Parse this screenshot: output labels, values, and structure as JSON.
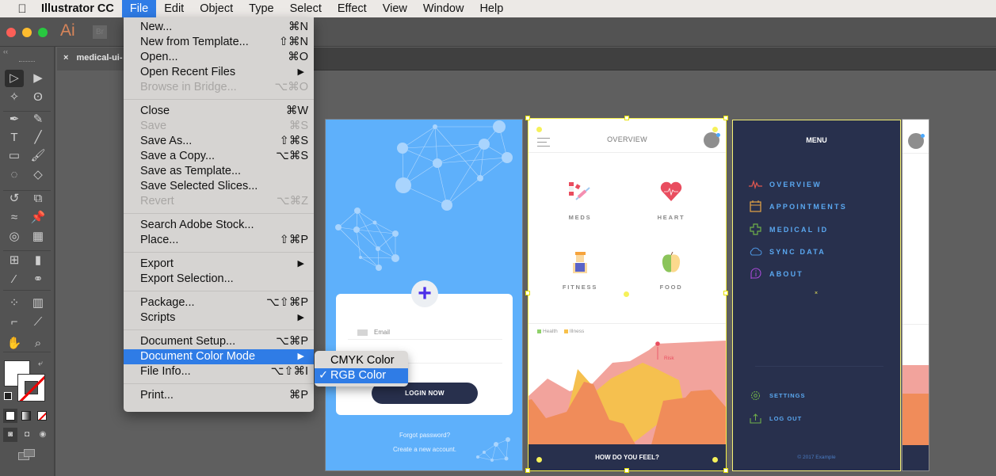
{
  "menubar": {
    "app_name": "Illustrator CC",
    "items": [
      "File",
      "Edit",
      "Object",
      "Type",
      "Select",
      "Effect",
      "View",
      "Window",
      "Help"
    ],
    "active": "File"
  },
  "appbar": {
    "ai_logo": "Ai",
    "br_logo": "Br",
    "traffic_colors": [
      "#fc5f57",
      "#fdbc2e",
      "#28c840"
    ]
  },
  "tab": {
    "close": "×",
    "title": "medical-ui-"
  },
  "toolbar": {
    "collapse": "‹‹",
    "tools": [
      {
        "name": "selection-tool",
        "glyph": "▷",
        "selected": true
      },
      {
        "name": "direct-selection-tool",
        "glyph": "▶"
      },
      {
        "name": "magic-wand-tool",
        "glyph": "✧"
      },
      {
        "name": "lasso-tool",
        "glyph": "ʘ"
      },
      {
        "name": "pen-tool",
        "glyph": "✒"
      },
      {
        "name": "curvature-tool",
        "glyph": "✎"
      },
      {
        "name": "type-tool",
        "glyph": "T"
      },
      {
        "name": "line-tool",
        "glyph": "╱"
      },
      {
        "name": "rectangle-tool",
        "glyph": "▭"
      },
      {
        "name": "paintbrush-tool",
        "glyph": "🖌"
      },
      {
        "name": "shaper-tool",
        "glyph": "◌"
      },
      {
        "name": "eraser-tool",
        "glyph": "◇"
      },
      {
        "name": "rotate-tool",
        "glyph": "↺"
      },
      {
        "name": "scale-tool",
        "glyph": "⧉"
      },
      {
        "name": "warp-tool",
        "glyph": "≈"
      },
      {
        "name": "puppet-warp-tool",
        "glyph": "📌"
      },
      {
        "name": "shape-builder-tool",
        "glyph": "◎"
      },
      {
        "name": "perspective-grid-tool",
        "glyph": "▦"
      },
      {
        "name": "mesh-tool",
        "glyph": "⊞"
      },
      {
        "name": "gradient-tool",
        "glyph": "▮"
      },
      {
        "name": "eyedropper-tool",
        "glyph": "⁄"
      },
      {
        "name": "blend-tool",
        "glyph": "⚭"
      },
      {
        "name": "symbol-sprayer-tool",
        "glyph": "⁘"
      },
      {
        "name": "column-graph-tool",
        "glyph": "▥"
      },
      {
        "name": "artboard-tool",
        "glyph": "⌐"
      },
      {
        "name": "slice-tool",
        "glyph": "⟋"
      },
      {
        "name": "hand-tool",
        "glyph": "✋"
      },
      {
        "name": "zoom-tool",
        "glyph": "⌕"
      }
    ]
  },
  "file_menu": {
    "groups": [
      [
        {
          "label": "New...",
          "shortcut": "⌘N"
        },
        {
          "label": "New from Template...",
          "shortcut": "⇧⌘N"
        },
        {
          "label": "Open...",
          "shortcut": "⌘O"
        },
        {
          "label": "Open Recent Files",
          "submenu": true
        },
        {
          "label": "Browse in Bridge...",
          "shortcut": "⌥⌘O",
          "disabled": true
        }
      ],
      [
        {
          "label": "Close",
          "shortcut": "⌘W"
        },
        {
          "label": "Save",
          "shortcut": "⌘S",
          "disabled": true
        },
        {
          "label": "Save As...",
          "shortcut": "⇧⌘S"
        },
        {
          "label": "Save a Copy...",
          "shortcut": "⌥⌘S"
        },
        {
          "label": "Save as Template..."
        },
        {
          "label": "Save Selected Slices..."
        },
        {
          "label": "Revert",
          "shortcut": "⌥⌘Z",
          "disabled": true
        }
      ],
      [
        {
          "label": "Search Adobe Stock..."
        },
        {
          "label": "Place...",
          "shortcut": "⇧⌘P"
        }
      ],
      [
        {
          "label": "Export",
          "submenu": true
        },
        {
          "label": "Export Selection..."
        }
      ],
      [
        {
          "label": "Package...",
          "shortcut": "⌥⇧⌘P"
        },
        {
          "label": "Scripts",
          "submenu": true
        }
      ],
      [
        {
          "label": "Document Setup...",
          "shortcut": "⌥⌘P"
        },
        {
          "label": "Document Color Mode",
          "submenu": true,
          "highlighted": true
        },
        {
          "label": "File Info...",
          "shortcut": "⌥⇧⌘I"
        }
      ],
      [
        {
          "label": "Print...",
          "shortcut": "⌘P"
        }
      ]
    ]
  },
  "color_mode_submenu": {
    "items": [
      {
        "label": "CMYK Color",
        "checked": false
      },
      {
        "label": "RGB Color",
        "checked": true
      }
    ],
    "check_glyph": "✓"
  },
  "login_screen": {
    "email_placeholder": "Email",
    "login_button": "LOGIN NOW",
    "forgot": "Forgot password?",
    "create": "Create a new account.",
    "bg_color": "#5eb0fb",
    "plus_color": "#4b2de8"
  },
  "overview_screen": {
    "title": "OVERVIEW",
    "tiles": [
      "MEDS",
      "HEART",
      "FITNESS",
      "FOOD"
    ],
    "legend": [
      {
        "label": "Health",
        "color": "#8fd16a"
      },
      {
        "label": "Illness",
        "color": "#f7c04a"
      }
    ],
    "risk_label": "Risk",
    "footer": "HOW DO YOU FEEL?",
    "footer_color": "#28304d"
  },
  "menu_screen": {
    "title": "MENU",
    "items": [
      {
        "label": "OVERVIEW",
        "icon": "pulse-icon",
        "color": "#e0574f"
      },
      {
        "label": "APPOINTMENTS",
        "icon": "calendar-icon",
        "color": "#e6a445"
      },
      {
        "label": "MEDICAL ID",
        "icon": "medical-cross-icon",
        "color": "#6fb04a"
      },
      {
        "label": "SYNC DATA",
        "icon": "cloud-icon",
        "color": "#4a8fd8"
      },
      {
        "label": "ABOUT",
        "icon": "info-icon",
        "color": "#a84ad8"
      }
    ],
    "bottom_items": [
      {
        "label": "SETTINGS",
        "icon": "gear-icon",
        "color": "#6fb04a"
      },
      {
        "label": "LOG OUT",
        "icon": "logout-icon",
        "color": "#6fb04a"
      }
    ],
    "copyright": "© 2017 Example"
  }
}
